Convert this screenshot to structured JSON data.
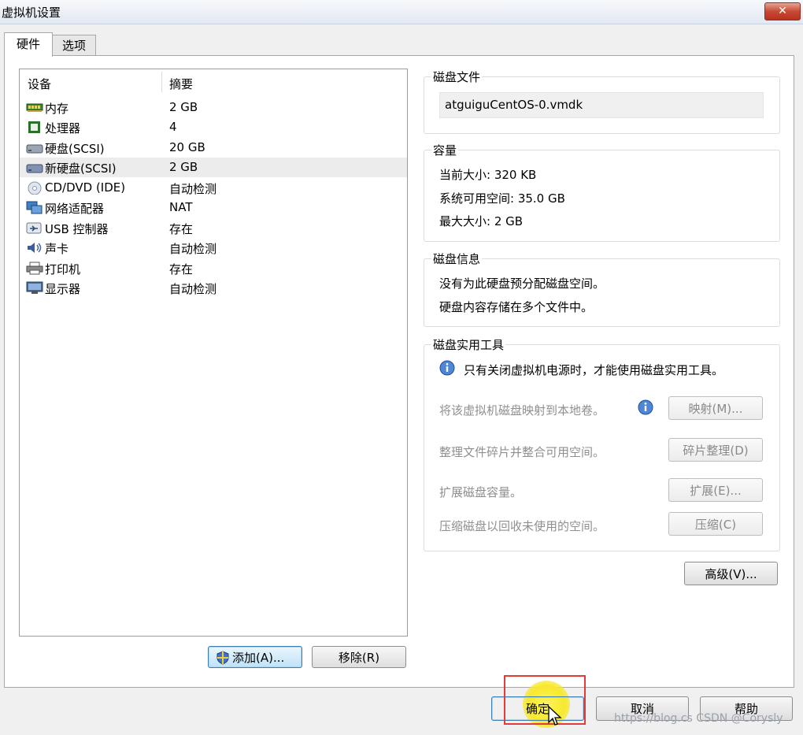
{
  "window": {
    "title": "虚拟机设置",
    "close_label": "✕"
  },
  "tabs": [
    {
      "label": "硬件"
    },
    {
      "label": "选项"
    }
  ],
  "device_list": {
    "col_device": "设备",
    "col_summary": "摘要",
    "rows": [
      {
        "name": "内存",
        "summary": "2 GB",
        "icon": "memory-icon"
      },
      {
        "name": "处理器",
        "summary": "4",
        "icon": "processor-icon"
      },
      {
        "name": "硬盘(SCSI)",
        "summary": "20 GB",
        "icon": "hard-disk-icon"
      },
      {
        "name": "新硬盘(SCSI)",
        "summary": "2 GB",
        "icon": "hard-disk-icon",
        "selected": true
      },
      {
        "name": "CD/DVD (IDE)",
        "summary": "自动检测",
        "icon": "cd-dvd-icon"
      },
      {
        "name": "网络适配器",
        "summary": "NAT",
        "icon": "network-adapter-icon"
      },
      {
        "name": "USB 控制器",
        "summary": "存在",
        "icon": "usb-icon"
      },
      {
        "name": "声卡",
        "summary": "自动检测",
        "icon": "sound-card-icon"
      },
      {
        "name": "打印机",
        "summary": "存在",
        "icon": "printer-icon"
      },
      {
        "name": "显示器",
        "summary": "自动检测",
        "icon": "display-icon"
      }
    ]
  },
  "left_buttons": {
    "add": "添加(A)...",
    "remove": "移除(R)"
  },
  "disk_file": {
    "title": "磁盘文件",
    "value": "atguiguCentOS-0.vmdk"
  },
  "capacity": {
    "title": "容量",
    "current": "当前大小: 320 KB",
    "available": "系统可用空间: 35.0 GB",
    "max": "最大大小: 2 GB"
  },
  "disk_info": {
    "title": "磁盘信息",
    "line1": "没有为此硬盘预分配磁盘空间。",
    "line2": "硬盘内容存储在多个文件中。"
  },
  "disk_tools": {
    "title": "磁盘实用工具",
    "notice": "只有关闭虚拟机电源时，才能使用磁盘实用工具。",
    "map_text": "将该虚拟机磁盘映射到本地卷。",
    "map_button": "映射(M)...",
    "defrag_text": "整理文件碎片并整合可用空间。",
    "defrag_button": "碎片整理(D)",
    "expand_text": "扩展磁盘容量。",
    "expand_button": "扩展(E)...",
    "compact_text": "压缩磁盘以回收未使用的空间。",
    "compact_button": "压缩(C)"
  },
  "advanced_button": "高级(V)...",
  "footer": {
    "ok": "确定",
    "cancel": "取消",
    "help": "帮助"
  },
  "watermark": "https://blog.cs CSDN @Corysly",
  "colors": {
    "highlight": "#e53a3a",
    "cursor_halo": "#f7e82d",
    "selection": "#ececec"
  }
}
